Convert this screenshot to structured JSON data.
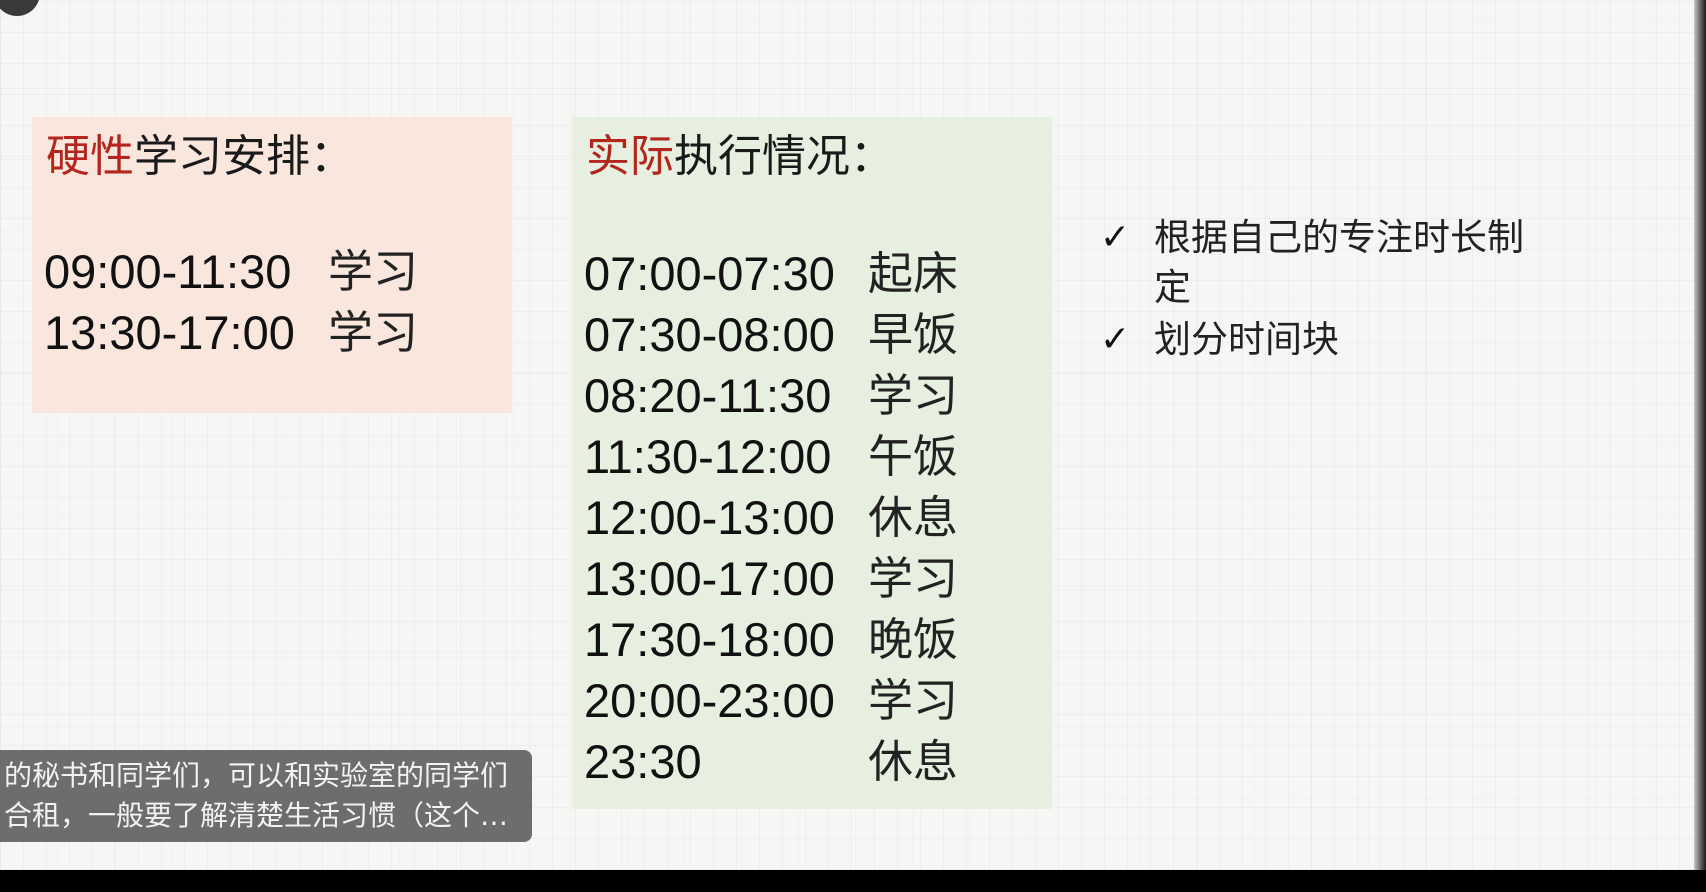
{
  "plan": {
    "title_accent": "硬性",
    "title_rest": "学习安排：",
    "rows": [
      {
        "time": "09:00-11:30",
        "activity": "学习"
      },
      {
        "time": "13:30-17:00",
        "activity": "学习"
      }
    ]
  },
  "actual": {
    "title_accent": "实际",
    "title_rest": "执行情况：",
    "rows": [
      {
        "time": "07:00-07:30",
        "activity": "起床"
      },
      {
        "time": "07:30-08:00",
        "activity": "早饭"
      },
      {
        "time": "08:20-11:30",
        "activity": "学习"
      },
      {
        "time": "11:30-12:00",
        "activity": "午饭"
      },
      {
        "time": "12:00-13:00",
        "activity": "休息"
      },
      {
        "time": "13:00-17:00",
        "activity": "学习"
      },
      {
        "time": "17:30-18:00",
        "activity": "晚饭"
      },
      {
        "time": "20:00-23:00",
        "activity": "学习"
      },
      {
        "time": "23:30",
        "activity": "休息"
      }
    ]
  },
  "notes": [
    {
      "icon": "check-icon",
      "mark": "✓",
      "text": "根据自己的专注时长制定"
    },
    {
      "icon": "check-icon",
      "mark": "✓",
      "text": "划分时间块"
    }
  ],
  "subtitle": {
    "line1": "的秘书和同学们，可以和实验室的同学们",
    "line2": "合租，一般要了解清楚生活习惯（这个…"
  },
  "colors": {
    "accent_red": "#b3261e",
    "plan_box_bg": "#f9e6dd",
    "actual_box_bg": "#e6efe0",
    "subtitle_bg": "#5a5a5a"
  }
}
